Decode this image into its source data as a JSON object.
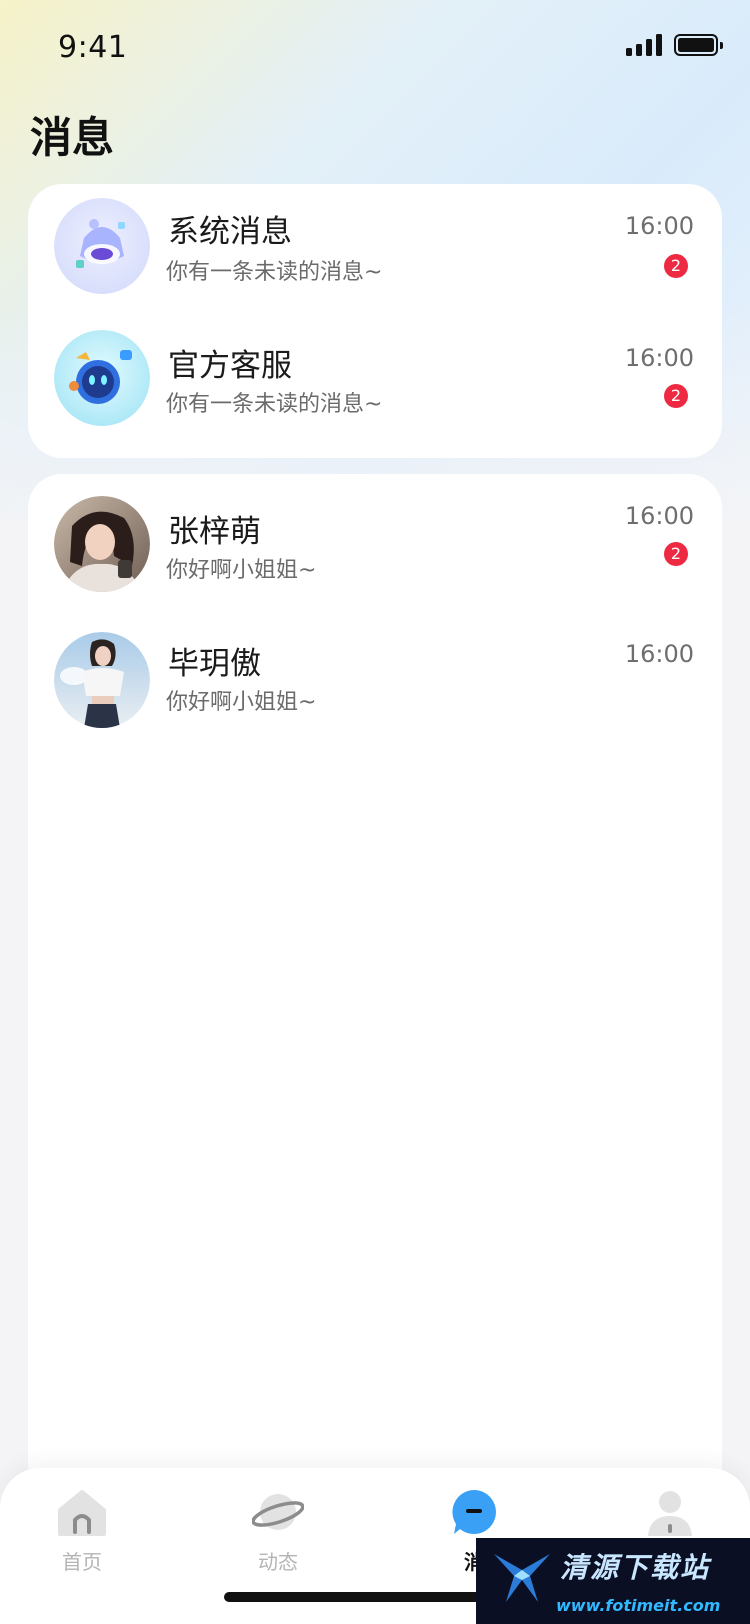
{
  "status_bar": {
    "time": "9:41"
  },
  "page_title": "消息",
  "system_messages": [
    {
      "name": "系统消息",
      "preview": "你有一条未读的消息~",
      "time": "16:00",
      "badge": "2"
    },
    {
      "name": "官方客服",
      "preview": "你有一条未读的消息~",
      "time": "16:00",
      "badge": "2"
    }
  ],
  "chats": [
    {
      "name": "张梓萌",
      "preview": "你好啊小姐姐~",
      "time": "16:00",
      "badge": "2"
    },
    {
      "name": "毕玥傲",
      "preview": "你好啊小姐姐~",
      "time": "16:00"
    }
  ],
  "tabbar": {
    "tabs": [
      {
        "label": "首页",
        "icon": "home-icon"
      },
      {
        "label": "动态",
        "icon": "planet-icon"
      },
      {
        "label": "消",
        "icon": "chat-bubble-icon",
        "active": true
      },
      {
        "label": "",
        "icon": "profile-icon"
      }
    ]
  },
  "watermark": {
    "title": "清源下载站",
    "url": "www.fotimeit.com"
  },
  "colors": {
    "badge": "#ee2a43",
    "active_tab": "#3aa0f5"
  }
}
